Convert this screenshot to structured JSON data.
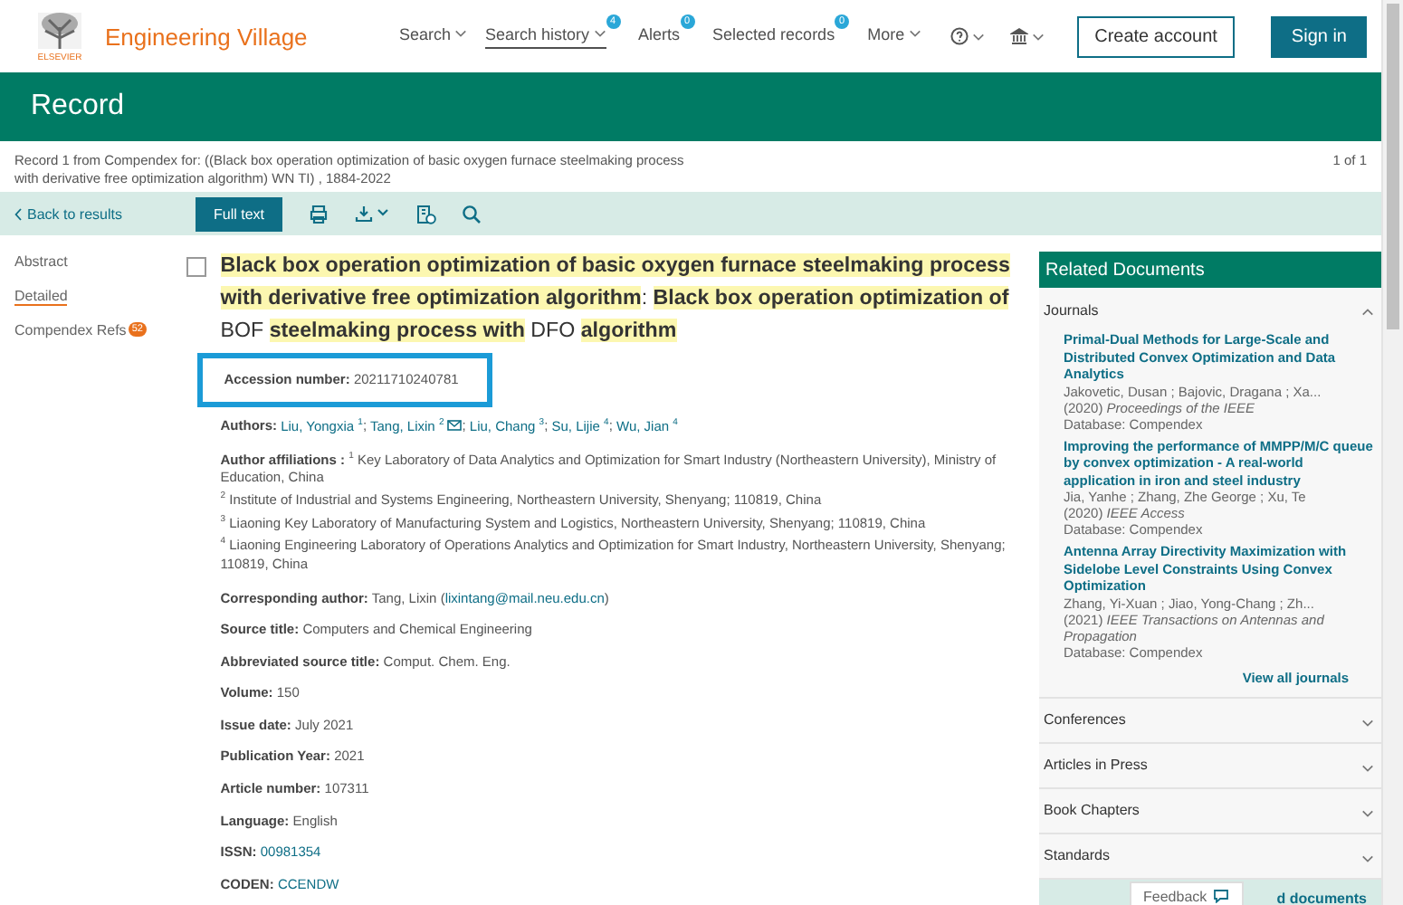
{
  "header": {
    "brand": "Engineering Village",
    "logo_text": "ELSEVIER",
    "nav": [
      {
        "label": "Search",
        "caret": true,
        "selected": false
      },
      {
        "label": "Search history",
        "badge": "4",
        "caret": true,
        "selected": true
      },
      {
        "label": "Alerts",
        "badge": "0",
        "caret": false,
        "selected": false
      },
      {
        "label": "Selected records",
        "badge": "0",
        "caret": false,
        "selected": false
      },
      {
        "label": "More",
        "caret": true,
        "selected": false
      }
    ],
    "create_account": "Create account",
    "sign_in": "Sign in"
  },
  "page_title": "Record",
  "record_info": "Record 1 from Compendex for: ((Black box operation optimization of basic oxygen furnace steelmaking process with derivative free optimization algorithm) WN TI) , 1884-2022",
  "record_count": "1 of 1",
  "toolbar": {
    "back": "Back to results",
    "full_text": "Full text"
  },
  "side_nav": [
    {
      "label": "Abstract",
      "selected": false
    },
    {
      "label": "Detailed",
      "selected": true
    },
    {
      "label": "Compendex Refs",
      "selected": false,
      "badge": "52"
    }
  ],
  "record": {
    "checked": false,
    "title": [
      {
        "text": "Black box operation optimization of basic oxygen furnace steelmaking process with derivative free optimization algorithm",
        "highlighted": true
      },
      {
        "text": ": ",
        "highlighted": false
      },
      {
        "text": "Black box operation optimization of",
        "highlighted": true
      },
      {
        "text": " BOF ",
        "highlighted": false
      },
      {
        "text": "steelmaking process with",
        "highlighted": true
      },
      {
        "text": " DFO ",
        "highlighted": false
      },
      {
        "text": "algorithm",
        "highlighted": true
      }
    ],
    "accession": {
      "label": "Accession number:",
      "value": "20211710240781"
    },
    "authors_label": "Authors:",
    "author_separator": ";",
    "authors": [
      {
        "name": "Liu, Yongxia",
        "sup": "1",
        "email": false
      },
      {
        "name": "Tang, Lixin",
        "sup": "2",
        "email": true
      },
      {
        "name": "Liu, Chang",
        "sup": "3",
        "email": false
      },
      {
        "name": "Su, Lijie",
        "sup": "4",
        "email": false
      },
      {
        "name": "Wu, Jian",
        "sup": "4",
        "email": false
      }
    ],
    "affiliations_label": "Author affiliations :",
    "affiliations": [
      {
        "sup": "1",
        "text": "Key Laboratory of Data Analytics and Optimization for Smart Industry (Northeastern University), Ministry of Education, China"
      },
      {
        "sup": "2",
        "text": "Institute of Industrial and Systems Engineering, Northeastern University, Shenyang; 110819, China"
      },
      {
        "sup": "3",
        "text": "Liaoning Key Laboratory of Manufacturing System and Logistics, Northeastern University, Shenyang; 110819, China"
      },
      {
        "sup": "4",
        "text": "Liaoning Engineering Laboratory of Operations Analytics and Optimization for Smart Industry, Northeastern University, Shenyang; 110819, China"
      }
    ],
    "fields": [
      {
        "label": "Corresponding author:",
        "parts": [
          {
            "text": "Tang, Lixin (",
            "link": false
          },
          {
            "text": "lixintang@mail.neu.edu.cn",
            "link": true
          },
          {
            "text": ")",
            "link": false
          }
        ]
      },
      {
        "label": "Source title:",
        "parts": [
          {
            "text": "Computers and Chemical Engineering",
            "link": false
          }
        ]
      },
      {
        "label": "Abbreviated source title:",
        "parts": [
          {
            "text": "Comput. Chem. Eng.",
            "link": false
          }
        ]
      },
      {
        "label": "Volume:",
        "parts": [
          {
            "text": "150",
            "link": false
          }
        ]
      },
      {
        "label": "Issue date:",
        "parts": [
          {
            "text": "July 2021",
            "link": false
          }
        ]
      },
      {
        "label": "Publication Year:",
        "parts": [
          {
            "text": "2021",
            "link": false
          }
        ]
      },
      {
        "label": "Article number:",
        "parts": [
          {
            "text": "107311",
            "link": false
          }
        ]
      },
      {
        "label": "Language:",
        "parts": [
          {
            "text": "English",
            "link": false
          }
        ]
      },
      {
        "label": "ISSN:",
        "parts": [
          {
            "text": "00981354",
            "link": true
          }
        ]
      },
      {
        "label": "CODEN:",
        "parts": [
          {
            "text": "CCENDW",
            "link": true
          }
        ]
      }
    ]
  },
  "related": {
    "title": "Related Documents",
    "sections": [
      {
        "label": "Journals",
        "expanded": true,
        "items": [
          {
            "title": "Primal-Dual Methods for Large-Scale and Distributed Convex Optimization and Data Analytics",
            "authors": "Jakovetic, Dusan ; Bajovic, Dragana ; Xa...",
            "year": "(2020)",
            "source": "Proceedings of the IEEE",
            "database": "Database: Compendex"
          },
          {
            "title": "Improving the performance of MMPP/M/C queue by convex optimization - A real-world application in iron and steel industry",
            "authors": "Jia, Yanhe ; Zhang, Zhe George ; Xu, Te",
            "year": "(2020)",
            "source": "IEEE Access",
            "database": "Database: Compendex"
          },
          {
            "title": "Antenna Array Directivity Maximization with Sidelobe Level Constraints Using Convex Optimization",
            "authors": "Zhang, Yi-Xuan ; Jiao, Yong-Chang ; Zh...",
            "year": "(2021)",
            "source": "IEEE Transactions on Antennas and Propagation",
            "database": "Database: Compendex"
          }
        ],
        "view_all": "View all journals"
      },
      {
        "label": "Conferences",
        "expanded": false
      },
      {
        "label": "Articles in Press",
        "expanded": false
      },
      {
        "label": "Book Chapters",
        "expanded": false
      },
      {
        "label": "Standards",
        "expanded": false
      }
    ],
    "footer_link": "d documents"
  },
  "feedback": "Feedback"
}
